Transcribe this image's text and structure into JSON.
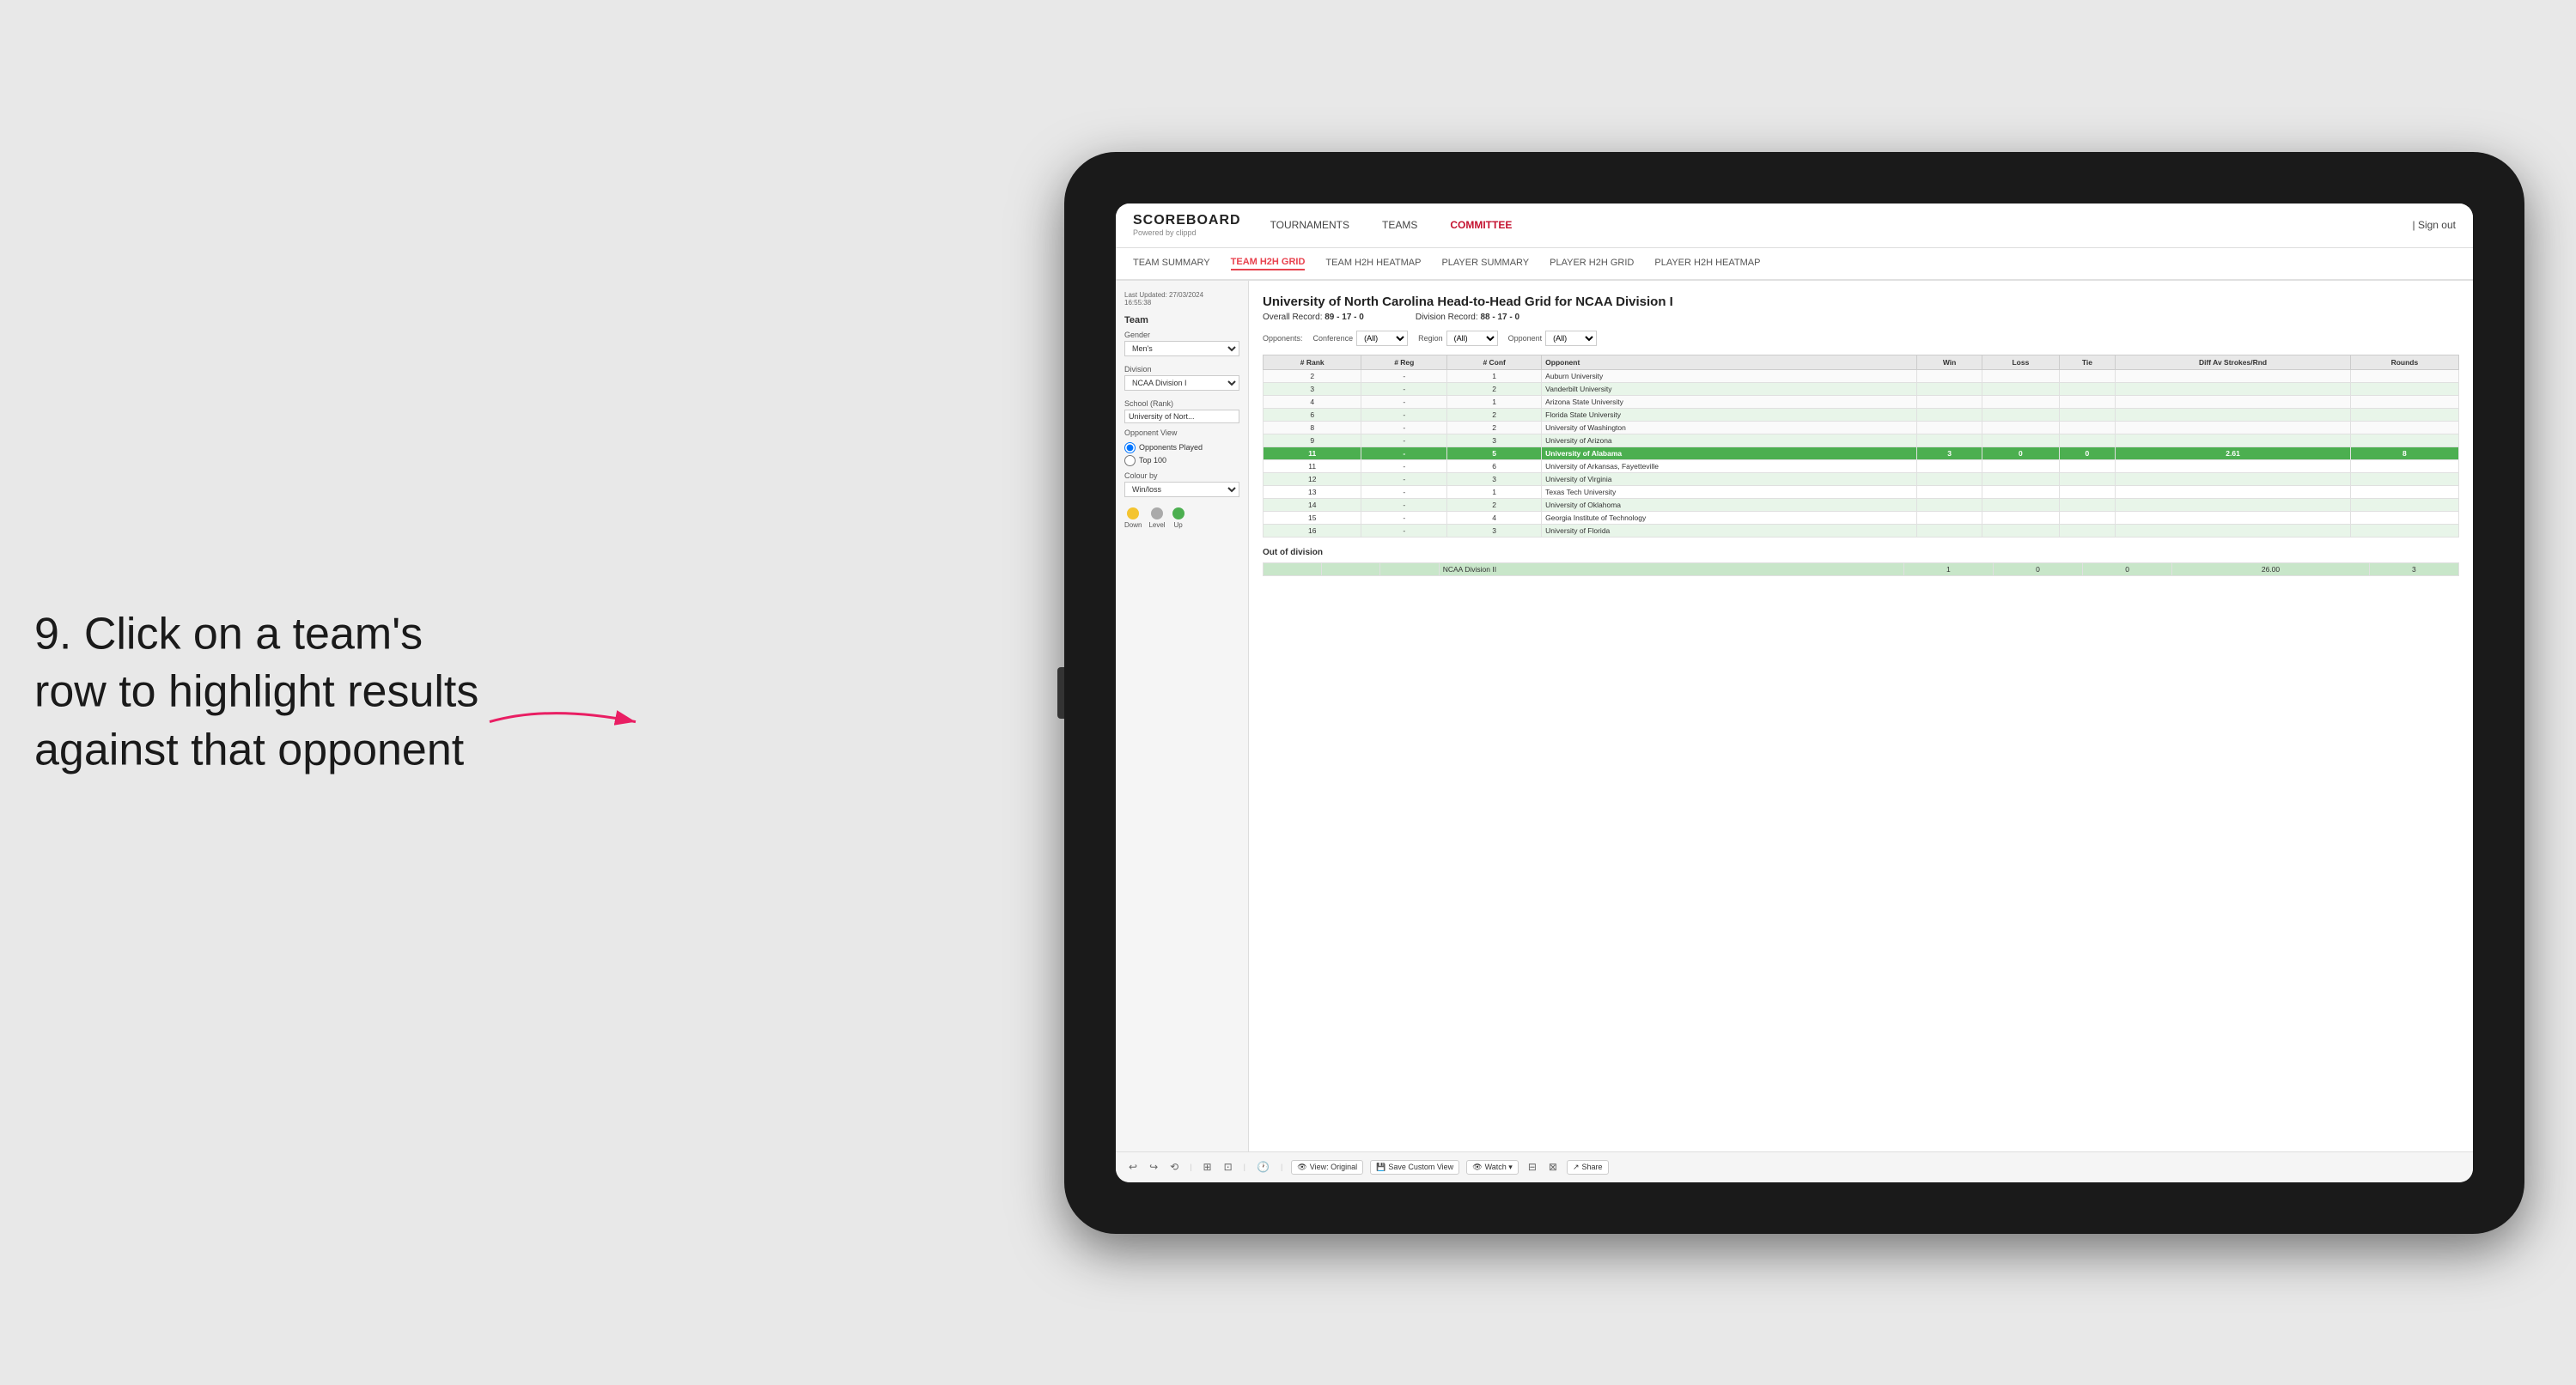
{
  "instruction": {
    "step_number": "9.",
    "text": "Click on a team's row to highlight results against that opponent"
  },
  "nav": {
    "logo": "SCOREBOARD",
    "logo_sub": "Powered by clippd",
    "links": [
      "TOURNAMENTS",
      "TEAMS",
      "COMMITTEE"
    ],
    "sign_out": "Sign out"
  },
  "sub_nav": {
    "links": [
      "TEAM SUMMARY",
      "TEAM H2H GRID",
      "TEAM H2H HEATMAP",
      "PLAYER SUMMARY",
      "PLAYER H2H GRID",
      "PLAYER H2H HEATMAP"
    ],
    "active": "TEAM H2H GRID"
  },
  "sidebar": {
    "timestamp_label": "Last Updated: 27/03/2024",
    "timestamp_time": "16:55:38",
    "team_label": "Team",
    "gender_label": "Gender",
    "gender_value": "Men's",
    "division_label": "Division",
    "division_value": "NCAA Division I",
    "school_label": "School (Rank)",
    "school_value": "University of Nort...",
    "opponent_view_label": "Opponent View",
    "opponent_view_options": [
      "Opponents Played",
      "Top 100"
    ],
    "opponent_view_selected": "Opponents Played",
    "colour_by_label": "Colour by",
    "colour_by_value": "Win/loss",
    "legend": {
      "down_label": "Down",
      "level_label": "Level",
      "up_label": "Up",
      "down_color": "#f4c430",
      "level_color": "#aaaaaa",
      "up_color": "#4caf50"
    }
  },
  "grid": {
    "title": "University of North Carolina Head-to-Head Grid for NCAA Division I",
    "overall_record_label": "Overall Record:",
    "overall_record": "89 - 17 - 0",
    "division_record_label": "Division Record:",
    "division_record": "88 - 17 - 0",
    "filters": {
      "opponents_label": "Opponents:",
      "conference_label": "Conference",
      "conference_value": "(All)",
      "region_label": "Region",
      "region_value": "(All)",
      "opponent_label": "Opponent",
      "opponent_value": "(All)"
    },
    "columns": [
      "# Rank",
      "# Reg",
      "# Conf",
      "Opponent",
      "Win",
      "Loss",
      "Tie",
      "Diff Av Strokes/Rnd",
      "Rounds"
    ],
    "rows": [
      {
        "rank": "2",
        "reg": "-",
        "conf": "1",
        "opponent": "Auburn University",
        "win": "",
        "loss": "",
        "tie": "",
        "diff": "",
        "rounds": "",
        "highlight": false,
        "light_green": false
      },
      {
        "rank": "3",
        "reg": "-",
        "conf": "2",
        "opponent": "Vanderbilt University",
        "win": "",
        "loss": "",
        "tie": "",
        "diff": "",
        "rounds": "",
        "highlight": false,
        "light_green": true
      },
      {
        "rank": "4",
        "reg": "-",
        "conf": "1",
        "opponent": "Arizona State University",
        "win": "",
        "loss": "",
        "tie": "",
        "diff": "",
        "rounds": "",
        "highlight": false,
        "light_green": false
      },
      {
        "rank": "6",
        "reg": "-",
        "conf": "2",
        "opponent": "Florida State University",
        "win": "",
        "loss": "",
        "tie": "",
        "diff": "",
        "rounds": "",
        "highlight": false,
        "light_green": true
      },
      {
        "rank": "8",
        "reg": "-",
        "conf": "2",
        "opponent": "University of Washington",
        "win": "",
        "loss": "",
        "tie": "",
        "diff": "",
        "rounds": "",
        "highlight": false,
        "light_green": false
      },
      {
        "rank": "9",
        "reg": "-",
        "conf": "3",
        "opponent": "University of Arizona",
        "win": "",
        "loss": "",
        "tie": "",
        "diff": "",
        "rounds": "",
        "highlight": false,
        "light_green": true
      },
      {
        "rank": "11",
        "reg": "-",
        "conf": "5",
        "opponent": "University of Alabama",
        "win": "3",
        "loss": "0",
        "tie": "0",
        "diff": "2.61",
        "rounds": "8",
        "highlight": true,
        "light_green": false
      },
      {
        "rank": "11",
        "reg": "-",
        "conf": "6",
        "opponent": "University of Arkansas, Fayetteville",
        "win": "",
        "loss": "",
        "tie": "",
        "diff": "",
        "rounds": "",
        "highlight": false,
        "light_green": false
      },
      {
        "rank": "12",
        "reg": "-",
        "conf": "3",
        "opponent": "University of Virginia",
        "win": "",
        "loss": "",
        "tie": "",
        "diff": "",
        "rounds": "",
        "highlight": false,
        "light_green": true
      },
      {
        "rank": "13",
        "reg": "-",
        "conf": "1",
        "opponent": "Texas Tech University",
        "win": "",
        "loss": "",
        "tie": "",
        "diff": "",
        "rounds": "",
        "highlight": false,
        "light_green": false
      },
      {
        "rank": "14",
        "reg": "-",
        "conf": "2",
        "opponent": "University of Oklahoma",
        "win": "",
        "loss": "",
        "tie": "",
        "diff": "",
        "rounds": "",
        "highlight": false,
        "light_green": true
      },
      {
        "rank": "15",
        "reg": "-",
        "conf": "4",
        "opponent": "Georgia Institute of Technology",
        "win": "",
        "loss": "",
        "tie": "",
        "diff": "",
        "rounds": "",
        "highlight": false,
        "light_green": false
      },
      {
        "rank": "16",
        "reg": "-",
        "conf": "3",
        "opponent": "University of Florida",
        "win": "",
        "loss": "",
        "tie": "",
        "diff": "",
        "rounds": "",
        "highlight": false,
        "light_green": true
      }
    ],
    "out_of_division_label": "Out of division",
    "out_of_division_row": {
      "division": "NCAA Division II",
      "win": "1",
      "loss": "0",
      "tie": "0",
      "diff": "26.00",
      "rounds": "3"
    }
  },
  "toolbar": {
    "undo_icon": "↩",
    "redo_icon": "↪",
    "history_icon": "⟲",
    "view_label": "View: Original",
    "save_label": "Save Custom View",
    "watch_label": "Watch ▾",
    "share_label": "Share"
  }
}
